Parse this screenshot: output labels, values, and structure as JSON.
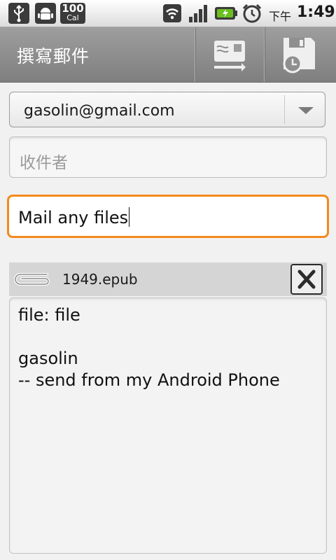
{
  "status_bar": {
    "calendar_badge_number": "100",
    "calendar_badge_unit": "Cal",
    "ampm": "下午",
    "time": "1:49"
  },
  "title_bar": {
    "title": "撰寫郵件"
  },
  "compose": {
    "from_value": "gasolin@gmail.com",
    "to_placeholder": "收件者",
    "subject_value": "Mail any files",
    "attachment_name": "1949.epub",
    "body_lines": [
      "file: file",
      "",
      "gasolin",
      "-- send from my Android Phone"
    ]
  },
  "colors": {
    "focus_accent": "#f28a1e",
    "title_bar": "#8c8c8c"
  },
  "icons": {
    "usb": "usb-icon",
    "android": "android-icon",
    "wifi": "wifi-icon",
    "signal": "signal-icon",
    "battery": "battery-charging-icon",
    "alarm": "alarm-clock-icon",
    "send": "send-mail-icon",
    "save_draft": "save-draft-icon",
    "dropdown": "chevron-down-icon",
    "paperclip": "paperclip-icon",
    "remove": "close-icon"
  }
}
